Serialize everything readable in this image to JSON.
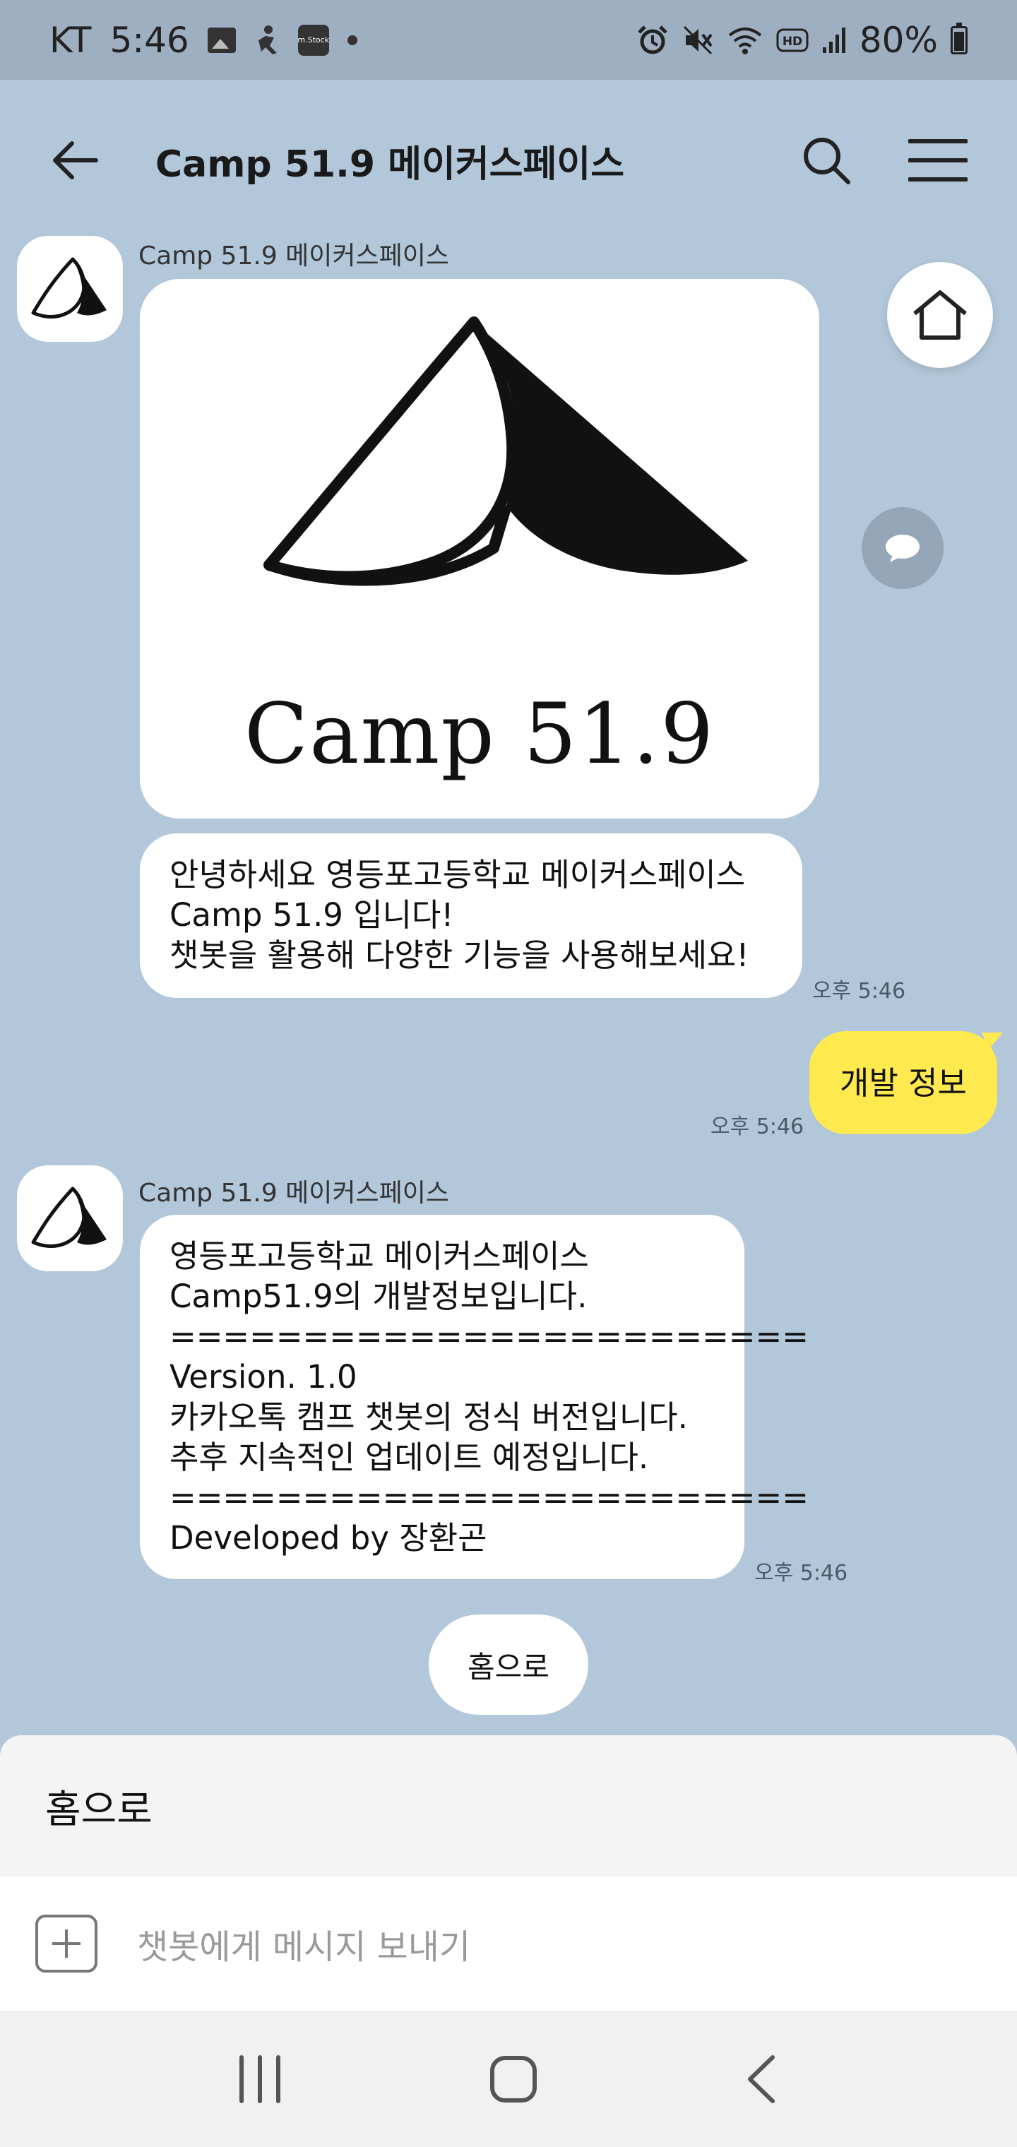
{
  "status_bar": {
    "carrier": "KT",
    "time": "5:46",
    "stock_icon_label": "m.Stock",
    "battery": "80%"
  },
  "app_bar": {
    "title": "Camp 51.9 메이커스페이스"
  },
  "messages": [
    {
      "sender": "Camp 51.9 메이커스페이스",
      "logo_text": "Camp 51.9",
      "text": "안녕하세요 영등포고등학교 메이커스페이스\nCamp 51.9 입니다!\n챗봇을 활용해 다양한 기능을 사용해보세요!",
      "time": "오후 5:46"
    },
    {
      "sender": "me",
      "text": "개발 정보",
      "time": "오후 5:46"
    },
    {
      "sender": "Camp 51.9 메이커스페이스",
      "text": "영등포고등학교 메이커스페이스\nCamp51.9의 개발정보입니다.\n========================\nVersion. 1.0\n카카오톡 캠프 챗봇의 정식 버전입니다.\n추후 지속적인 업데이트 예정입니다.\n========================\nDeveloped by 장환곤",
      "time": "오후 5:46"
    }
  ],
  "quick_reply": "홈으로",
  "bottom_sheet": {
    "label": "홈으로"
  },
  "input": {
    "placeholder": "챗봇에게 메시지 보내기"
  },
  "icons": {
    "back": "arrow-left-icon",
    "search": "search-icon",
    "menu": "hamburger-menu-icon",
    "home": "home-icon",
    "chat": "chat-bubble-icon",
    "plus": "plus-icon"
  }
}
